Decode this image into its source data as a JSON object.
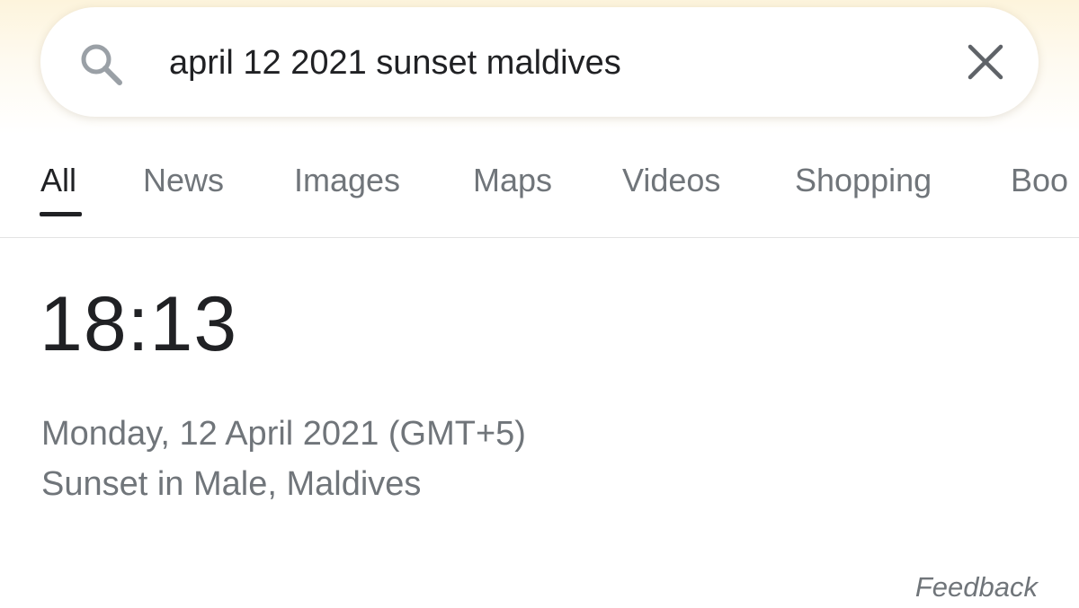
{
  "search": {
    "query": "april 12 2021 sunset maldives",
    "search_icon": "search-icon",
    "clear_icon": "close-icon"
  },
  "tabs": [
    {
      "label": "All",
      "active": true
    },
    {
      "label": "News",
      "active": false
    },
    {
      "label": "Images",
      "active": false
    },
    {
      "label": "Maps",
      "active": false
    },
    {
      "label": "Videos",
      "active": false
    },
    {
      "label": "Shopping",
      "active": false
    },
    {
      "label": "Boo",
      "active": false
    }
  ],
  "result": {
    "time": "18:13",
    "date": "Monday, 12 April 2021 (GMT+5)",
    "place": "Sunset in Male, Maldives"
  },
  "feedback_label": "Feedback",
  "colors": {
    "primary_text": "#202124",
    "secondary_text": "#70757a",
    "top_glow": "#fdf4dc"
  }
}
